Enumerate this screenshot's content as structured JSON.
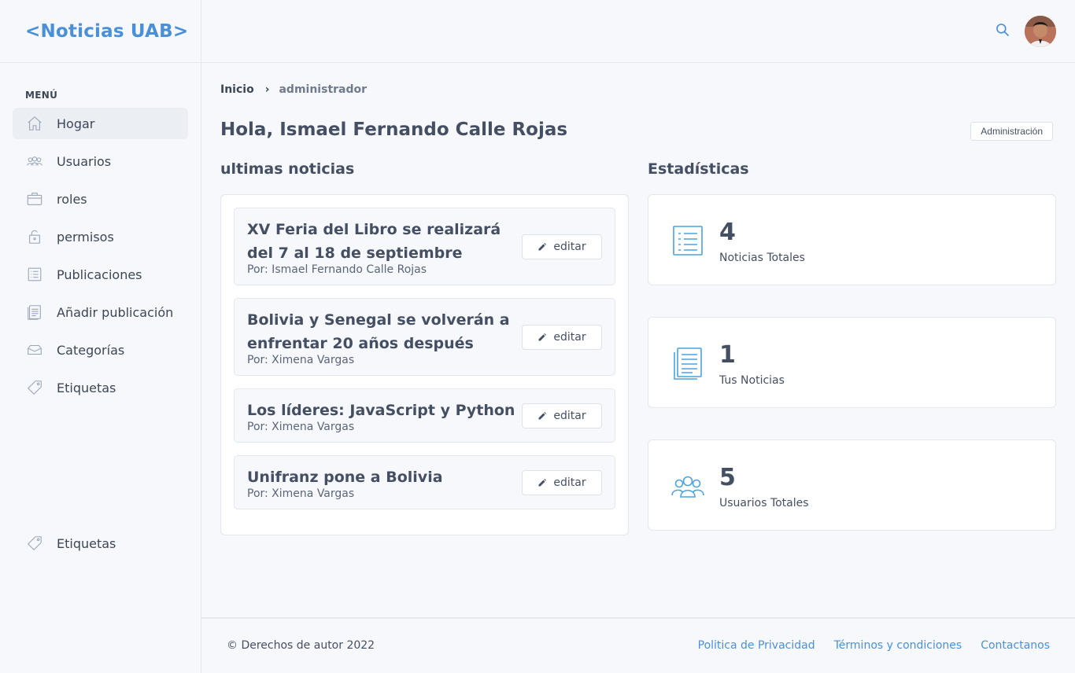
{
  "brand": {
    "title": "<Noticias UAB>"
  },
  "sidebar": {
    "heading": "MENÚ",
    "items": [
      {
        "label": "Hogar",
        "icon": "home-icon",
        "active": true
      },
      {
        "label": "Usuarios",
        "icon": "users-icon"
      },
      {
        "label": "roles",
        "icon": "briefcase-icon"
      },
      {
        "label": "permisos",
        "icon": "lock-icon"
      },
      {
        "label": "Publicaciones",
        "icon": "list-icon"
      },
      {
        "label": "Añadir publicación",
        "icon": "document-icon"
      },
      {
        "label": "Categorías",
        "icon": "inbox-icon"
      },
      {
        "label": "Etiquetas",
        "icon": "tag-icon"
      }
    ],
    "bottom_item": {
      "label": "Etiquetas",
      "icon": "tag-icon"
    }
  },
  "header": {
    "search_icon": "search-icon",
    "avatar": "user-avatar"
  },
  "breadcrumb": {
    "home": "Inicio",
    "separator": "›",
    "current": "administrador"
  },
  "greeting": "Hola, Ismael Fernando Calle Rojas",
  "admin_button": "Administración",
  "news": {
    "title": "ultimas noticias",
    "edit_label": "editar",
    "items": [
      {
        "headline": "XV Feria del Libro se realizará del 7 al 18 de septiembre",
        "author": "Por: Ismael Fernando Calle Rojas"
      },
      {
        "headline": "Bolivia y Senegal se volverán a enfrentar 20 años después",
        "author": "Por: Ximena Vargas"
      },
      {
        "headline": "Los líderes: JavaScript y Python",
        "author": "Por: Ximena Vargas"
      },
      {
        "headline": "Unifranz pone a Bolivia",
        "author": "Por: Ximena Vargas"
      }
    ]
  },
  "stats": {
    "title": "Estadísticas",
    "items": [
      {
        "value": "4",
        "label": "Noticias Totales",
        "icon": "list-icon"
      },
      {
        "value": "1",
        "label": "Tus Noticias",
        "icon": "document-icon"
      },
      {
        "value": "5",
        "label": "Usuarios Totales",
        "icon": "users-icon"
      }
    ]
  },
  "footer": {
    "copyright": "© Derechos de autor 2022",
    "links": [
      "Politica de Privacidad",
      "Términos y condiciones",
      "Contactanos"
    ]
  },
  "colors": {
    "accent": "#4a90d9",
    "icon_blue": "#4aa3df",
    "text": "#454f63",
    "background": "#f6f8fb"
  }
}
